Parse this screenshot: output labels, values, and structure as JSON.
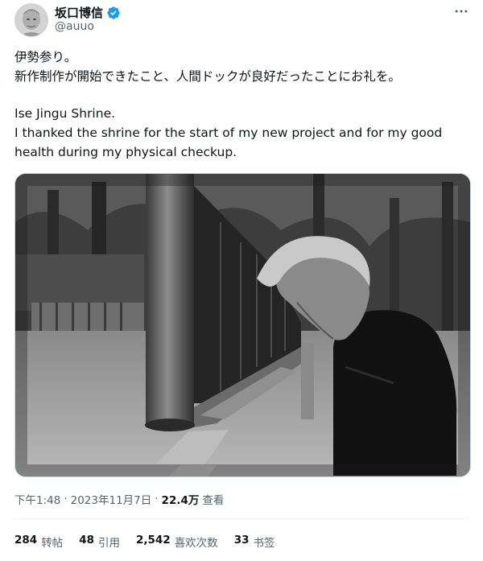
{
  "author": {
    "display_name": "坂口博信",
    "handle": "@auuo",
    "avatar_icon": "avatar-image",
    "verified_icon": "verified-badge-icon",
    "verified_color": "#1d9bf0"
  },
  "more_icon": "more-options-icon",
  "tweet": {
    "lines": [
      "伊勢参り。",
      "新作制作が開始できたこと、人間ドックが良好だったことにお礼を。",
      "",
      "Ise Jingu Shrine.",
      "I thanked the shrine for the start of my new project and for my good",
      "health during my physical checkup."
    ]
  },
  "media": {
    "type": "photo",
    "style": "black-and-white"
  },
  "meta": {
    "time": "下午1:48",
    "separator": "·",
    "date": "2023年11月7日",
    "separator2": "·",
    "views_count": "22.4万",
    "views_label": "查看"
  },
  "stats": [
    {
      "count": "284",
      "label": "转帖"
    },
    {
      "count": "48",
      "label": "引用"
    },
    {
      "count": "2,542",
      "label": "喜欢次数"
    },
    {
      "count": "33",
      "label": "书签"
    }
  ]
}
